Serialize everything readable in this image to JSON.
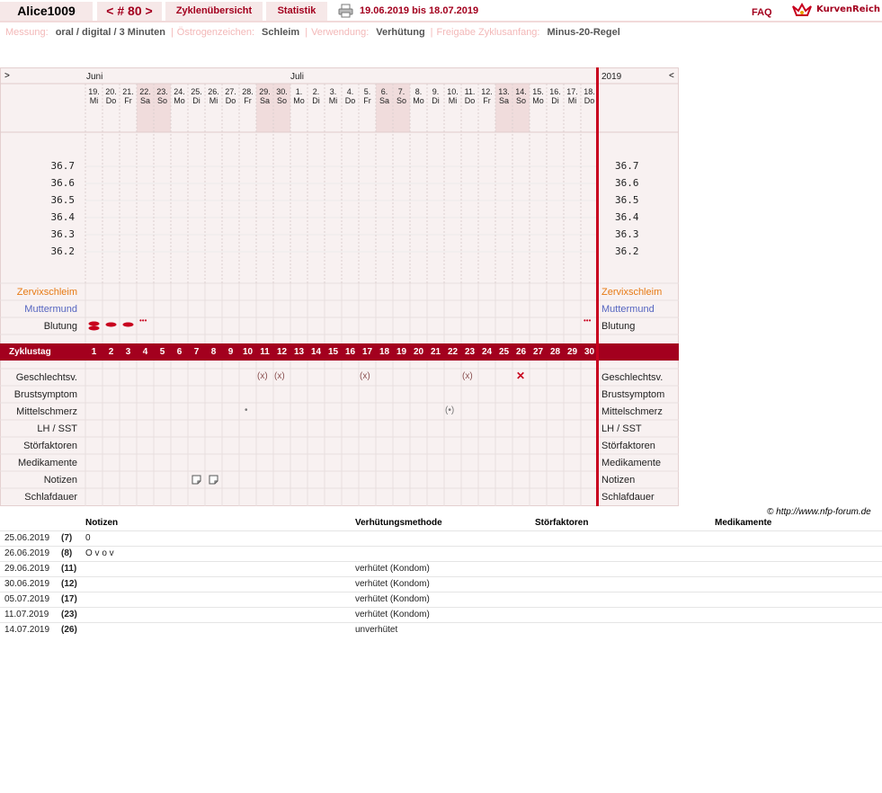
{
  "header": {
    "user": "Alice1009",
    "nav": "< # 80 >",
    "tab_zyklen": "Zyklenübersicht",
    "tab_statistik": "Statistik",
    "date_range": "19.06.2019 bis 18.07.2019",
    "faq": "FAQ",
    "logo": "KurvenReich"
  },
  "infobar": {
    "messung_label": "Messung:",
    "messung_value": "oral / digital / 3 Minuten",
    "oestrogen_label": "Östrogenzeichen:",
    "oestrogen_value": "Schleim",
    "verwendung_label": "Verwendung:",
    "verwendung_value": "Verhütung",
    "freigabe_label": "Freigabe Zyklusanfang:",
    "freigabe_value": "Minus-20-Regel"
  },
  "chart": {
    "arrow_left": ">",
    "arrow_right": "<",
    "month_1": "Juni",
    "month_2": "Juli",
    "year": "2019",
    "days": [
      {
        "n": "19.",
        "d": "Mi"
      },
      {
        "n": "20.",
        "d": "Do"
      },
      {
        "n": "21.",
        "d": "Fr"
      },
      {
        "n": "22.",
        "d": "Sa"
      },
      {
        "n": "23.",
        "d": "So"
      },
      {
        "n": "24.",
        "d": "Mo"
      },
      {
        "n": "25.",
        "d": "Di"
      },
      {
        "n": "26.",
        "d": "Mi"
      },
      {
        "n": "27.",
        "d": "Do"
      },
      {
        "n": "28.",
        "d": "Fr"
      },
      {
        "n": "29.",
        "d": "Sa"
      },
      {
        "n": "30.",
        "d": "So"
      },
      {
        "n": "1.",
        "d": "Mo"
      },
      {
        "n": "2.",
        "d": "Di"
      },
      {
        "n": "3.",
        "d": "Mi"
      },
      {
        "n": "4.",
        "d": "Do"
      },
      {
        "n": "5.",
        "d": "Fr"
      },
      {
        "n": "6.",
        "d": "Sa"
      },
      {
        "n": "7.",
        "d": "So"
      },
      {
        "n": "8.",
        "d": "Mo"
      },
      {
        "n": "9.",
        "d": "Di"
      },
      {
        "n": "10.",
        "d": "Mi"
      },
      {
        "n": "11.",
        "d": "Do"
      },
      {
        "n": "12.",
        "d": "Fr"
      },
      {
        "n": "13.",
        "d": "Sa"
      },
      {
        "n": "14.",
        "d": "So"
      },
      {
        "n": "15.",
        "d": "Mo"
      },
      {
        "n": "16.",
        "d": "Di"
      },
      {
        "n": "17.",
        "d": "Mi"
      },
      {
        "n": "18.",
        "d": "Do"
      }
    ],
    "weekend_days": [
      4,
      5,
      11,
      12,
      18,
      19,
      25,
      26
    ],
    "temp_labels": [
      "36.7",
      "36.6",
      "36.5",
      "36.4",
      "36.3",
      "36.2"
    ],
    "rows_top": {
      "zervix": "Zervixschleim",
      "muttermund": "Muttermund",
      "blutung": "Blutung"
    },
    "zyklustag_label": "Zyklustag",
    "cycle_days": [
      "1",
      "2",
      "3",
      "4",
      "5",
      "6",
      "7",
      "8",
      "9",
      "10",
      "11",
      "12",
      "13",
      "14",
      "15",
      "16",
      "17",
      "18",
      "19",
      "20",
      "21",
      "22",
      "23",
      "24",
      "25",
      "26",
      "27",
      "28",
      "29",
      "30"
    ],
    "rows_bottom": [
      "Geschlechtsv.",
      "Brustsymptom",
      "Mittelschmerz",
      "LH / SST",
      "Störfaktoren",
      "Medikamente",
      "Notizen",
      "Schlafdauer"
    ],
    "bleeding": [
      {
        "day": 1,
        "level": "heavy"
      },
      {
        "day": 2,
        "level": "medium"
      },
      {
        "day": 3,
        "level": "medium"
      },
      {
        "day": 4,
        "level": "spotting"
      },
      {
        "day": 30,
        "level": "spotting"
      }
    ],
    "sex_protected_days": [
      11,
      12,
      17,
      23
    ],
    "sex_unprotected_days": [
      26
    ],
    "mittelschmerz_dot_days": [
      10
    ],
    "mittelschmerz_circle_days": [
      22
    ],
    "notes_days": [
      7,
      8
    ],
    "sex_protected_symbol": "(x)",
    "sex_unprotected_symbol": "✕",
    "dot_symbol": "•",
    "circle_symbol": "(•)",
    "spotting_symbol": "•••"
  },
  "copyright": "© http://www.nfp-forum.de",
  "notes_table": {
    "headers": {
      "notizen": "Notizen",
      "methode": "Verhütungsmethode",
      "stoer": "Störfaktoren",
      "medi": "Medikamente"
    },
    "rows": [
      {
        "date": "25.06.2019",
        "day": "(7)",
        "note": "0",
        "method": ""
      },
      {
        "date": "26.06.2019",
        "day": "(8)",
        "note": "O v o v",
        "method": ""
      },
      {
        "date": "29.06.2019",
        "day": "(11)",
        "note": "",
        "method": "verhütet (Kondom)"
      },
      {
        "date": "30.06.2019",
        "day": "(12)",
        "note": "",
        "method": "verhütet (Kondom)"
      },
      {
        "date": "05.07.2019",
        "day": "(17)",
        "note": "",
        "method": "verhütet (Kondom)"
      },
      {
        "date": "11.07.2019",
        "day": "(23)",
        "note": "",
        "method": "verhütet (Kondom)"
      },
      {
        "date": "14.07.2019",
        "day": "(26)",
        "note": "",
        "method": "unverhütet"
      }
    ]
  }
}
